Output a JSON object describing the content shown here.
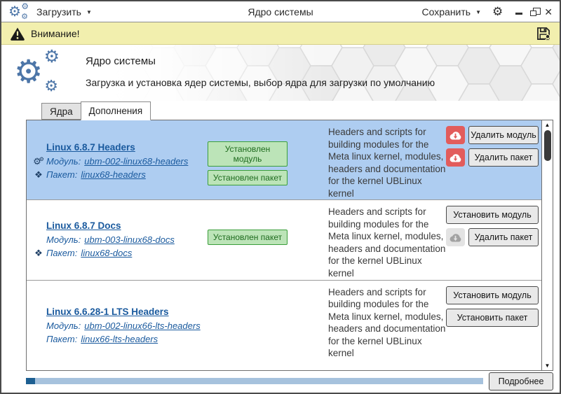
{
  "titlebar": {
    "load_menu": "Загрузить",
    "title": "Ядро системы",
    "save_menu": "Сохранить"
  },
  "warning_bar": {
    "text": "Внимание!"
  },
  "header": {
    "title": "Ядро системы",
    "subtitle": "Загрузка и установка ядер системы, выбор ядра для загрузки по умолчанию"
  },
  "tabs": {
    "kernels": "Ядра",
    "addons": "Дополнения"
  },
  "field_labels": {
    "module": "Модуль:",
    "package": "Пакет:"
  },
  "rows": [
    {
      "title": "Linux 6.8.7 Headers",
      "module": "ubm-002-linux68-headers",
      "package": "linux68-headers",
      "selected": true,
      "module_icon_visible": true,
      "package_icon_visible": true,
      "badges": [
        "Установлен модуль",
        "Установлен пакет"
      ],
      "description": "Headers and scripts for building modules for the Meta linux kernel, modules, headers and documentation for the kernel UBLinux kernel",
      "buttons": [
        {
          "label": "Удалить модуль",
          "icon": "cloud-download-red"
        },
        {
          "label": "Удалить пакет",
          "icon": "cloud-download-red"
        }
      ]
    },
    {
      "title": "Linux 6.8.7 Docs",
      "module": "ubm-003-linux68-docs",
      "package": "linux68-docs",
      "selected": false,
      "module_icon_visible": false,
      "package_icon_visible": true,
      "badges": [
        "Установлен пакет"
      ],
      "description": "Headers and scripts for building modules for the Meta linux kernel, modules, headers and documentation for the kernel UBLinux kernel",
      "buttons": [
        {
          "label": "Установить модуль",
          "icon": null
        },
        {
          "label": "Удалить пакет",
          "icon": "cloud-download-gray"
        }
      ]
    },
    {
      "title": "Linux 6.6.28-1 LTS Headers",
      "module": "ubm-002-linux66-lts-headers",
      "package": "linux66-lts-headers",
      "selected": false,
      "module_icon_visible": false,
      "package_icon_visible": false,
      "badges": [],
      "description": "Headers and scripts for building modules for the Meta linux kernel, modules, headers and documentation for the kernel UBLinux kernel",
      "buttons": [
        {
          "label": "Установить модуль",
          "icon": null
        },
        {
          "label": "Установить пакет",
          "icon": null
        }
      ]
    }
  ],
  "footer": {
    "details_button": "Подробнее",
    "progress_percent": 2
  },
  "colors": {
    "accent_blue": "#4d76a8",
    "selection_blue": "#aecdf1",
    "link_blue": "#1a5a9e",
    "warning_yellow": "#f2efae",
    "badge_green_border": "#3a9e3a",
    "badge_green_bg": "#bce4b8",
    "danger_red": "#e25c5c",
    "progress_blue": "#1d5f92"
  }
}
